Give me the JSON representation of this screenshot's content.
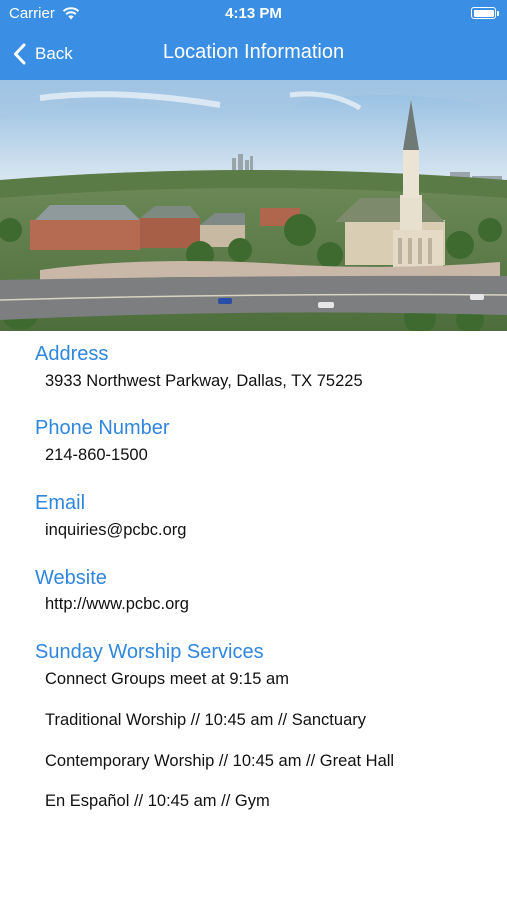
{
  "status_bar": {
    "carrier": "Carrier",
    "time": "4:13 PM",
    "battery_level": 1.0
  },
  "nav": {
    "back_label": "Back",
    "title": "Location Information"
  },
  "hero": {
    "alt": "Aerial view of church campus with steeple and city skyline"
  },
  "sections": {
    "address": {
      "heading": "Address",
      "value": "3933 Northwest Parkway, Dallas, TX 75225"
    },
    "phone": {
      "heading": "Phone Number",
      "value": "214-860-1500"
    },
    "email": {
      "heading": "Email",
      "value": "inquiries@pcbc.org"
    },
    "website": {
      "heading": "Website",
      "value": "http://www.pcbc.org"
    },
    "services": {
      "heading": "Sunday Worship Services",
      "items": [
        "Connect Groups meet at 9:15 am",
        "Traditional Worship // 10:45 am // Sanctuary",
        "Contemporary Worship // 10:45 am // Great Hall",
        "En Español // 10:45 am // Gym"
      ]
    }
  },
  "colors": {
    "nav_bar": "#3a8ee3",
    "heading": "#2f86de",
    "text": "#111111"
  }
}
